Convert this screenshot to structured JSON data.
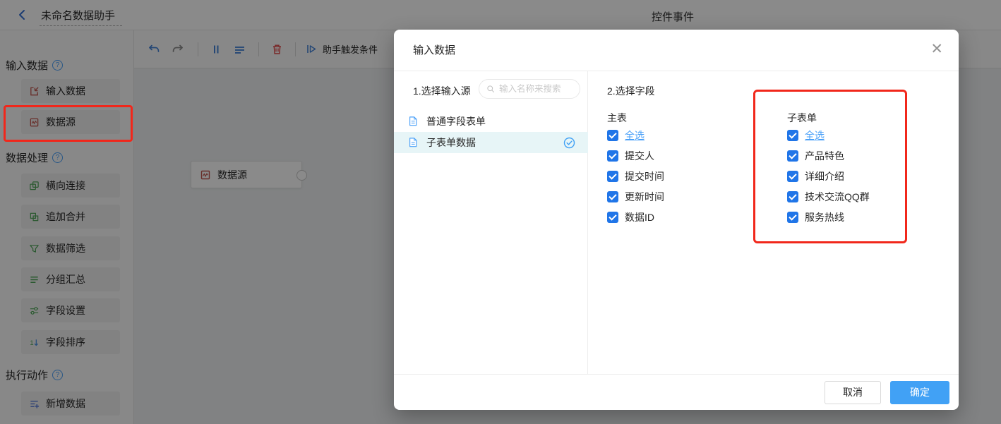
{
  "topbar": {
    "title": "未命名数据助手",
    "center_title": "控件事件"
  },
  "sidebar": {
    "sections": [
      {
        "label": "输入数据",
        "items": [
          {
            "label": "输入数据"
          },
          {
            "label": "数据源"
          }
        ]
      },
      {
        "label": "数据处理",
        "items": [
          {
            "label": "横向连接"
          },
          {
            "label": "追加合并"
          },
          {
            "label": "数据筛选"
          },
          {
            "label": "分组汇总"
          },
          {
            "label": "字段设置"
          },
          {
            "label": "字段排序"
          }
        ]
      },
      {
        "label": "执行动作",
        "items": [
          {
            "label": "新增数据"
          }
        ]
      }
    ]
  },
  "toolbar": {
    "trigger_label": "助手触发条件"
  },
  "canvas": {
    "node": {
      "label": "数据源"
    }
  },
  "modal": {
    "title": "输入数据",
    "source_panel": {
      "step_label": "1.选择输入源",
      "search_placeholder": "输入名称来搜索",
      "items": [
        {
          "label": "普通字段表单",
          "selected": false
        },
        {
          "label": "子表单数据",
          "selected": true
        }
      ]
    },
    "fields_panel": {
      "step_label": "2.选择字段",
      "groups": [
        {
          "title": "主表",
          "fields": [
            "全选",
            "提交人",
            "提交时间",
            "更新时间",
            "数据ID"
          ]
        },
        {
          "title": "子表单",
          "fields": [
            "全选",
            "产品特色",
            "详细介绍",
            "技术交流QQ群",
            "服务热线"
          ]
        }
      ]
    },
    "footer": {
      "cancel_label": "取消",
      "confirm_label": "确定"
    }
  },
  "icons": {
    "close": "✕",
    "help": "?"
  },
  "colors": {
    "checkbox_blue": "#2075e8",
    "confirm_blue": "#41a1f5",
    "link_blue": "#4aa0f8",
    "annotation_red": "#f1271b",
    "selected_row_bg": "#e7f5f7"
  }
}
